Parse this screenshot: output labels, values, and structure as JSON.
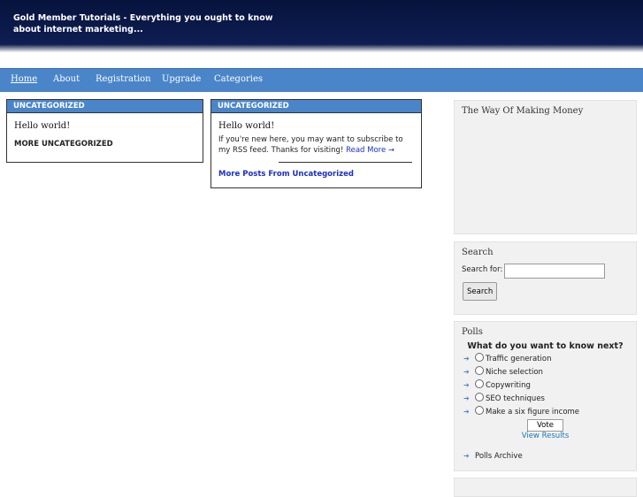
{
  "site": {
    "title": "Gold Member Tutorials - Everything you ought to know about internet marketing..."
  },
  "nav": [
    {
      "label": "Home"
    },
    {
      "label": "About"
    },
    {
      "label": "Registration"
    },
    {
      "label": "Upgrade"
    },
    {
      "label": "Categories"
    }
  ],
  "posts": [
    {
      "category": "UNCATEGORIZED",
      "title": "Hello world!",
      "more_label": "MORE UNCATEGORIZED"
    },
    {
      "category": "UNCATEGORIZED",
      "title": "Hello world!",
      "excerpt": "If you're new here, you may want to subscribe to my RSS feed. Thanks for visiting!",
      "read_more": "Read More →",
      "more_label": "More Posts From Uncategorized"
    }
  ],
  "sidebar": {
    "ad_title": "The Way Of Making Money",
    "search": {
      "title": "Search",
      "label": "Search for:",
      "value": "",
      "button": "Search"
    },
    "polls": {
      "title": "Polls",
      "question": "What do you want to know next?",
      "options": [
        "Traffic generation",
        "Niche selection",
        "Copywriting",
        "SEO techniques",
        "Make a six figure income"
      ],
      "vote_button": "Vote",
      "view_results": "View Results",
      "archive": "Polls Archive"
    }
  },
  "colors": {
    "header": "#0b1a4a",
    "nav": "#4a85c9",
    "link": "#1a2fc9"
  }
}
